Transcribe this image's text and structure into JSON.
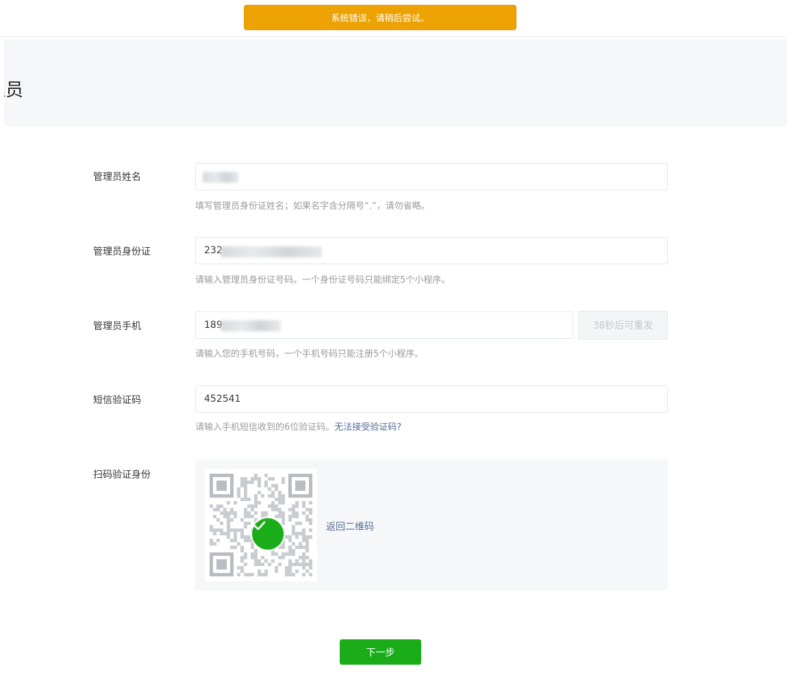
{
  "toast": {
    "message": "系统错误，请稍后尝试。",
    "color": "#eba202"
  },
  "header": {
    "title": "理员"
  },
  "form": {
    "admin_name": {
      "label": "管理员姓名",
      "value": "",
      "hint": "填写管理员身份证姓名；如果名字含分隔号“.”，请勿省略。"
    },
    "admin_id": {
      "label": "管理员身份证",
      "value": "232",
      "hint": "请输入管理员身份证号码。一个身份证号码只能绑定5个小程序。"
    },
    "admin_phone": {
      "label": "管理员手机",
      "value": "189",
      "hint": "请输入您的手机号码，一个手机号码只能注册5个小程序。",
      "resend_label": "38秒后可重发"
    },
    "sms_code": {
      "label": "短信验证码",
      "value": "452541",
      "hint": "请输入手机短信收到的6位验证码。",
      "hint_link": "无法接受验证码?"
    },
    "scan_verify": {
      "label": "扫码验证身份",
      "back_link": "返回二维码"
    }
  },
  "actions": {
    "next_label": "下一步"
  },
  "colors": {
    "primary_green": "#1aad19",
    "link_blue": "#576b95",
    "warning_orange": "#eba202"
  }
}
